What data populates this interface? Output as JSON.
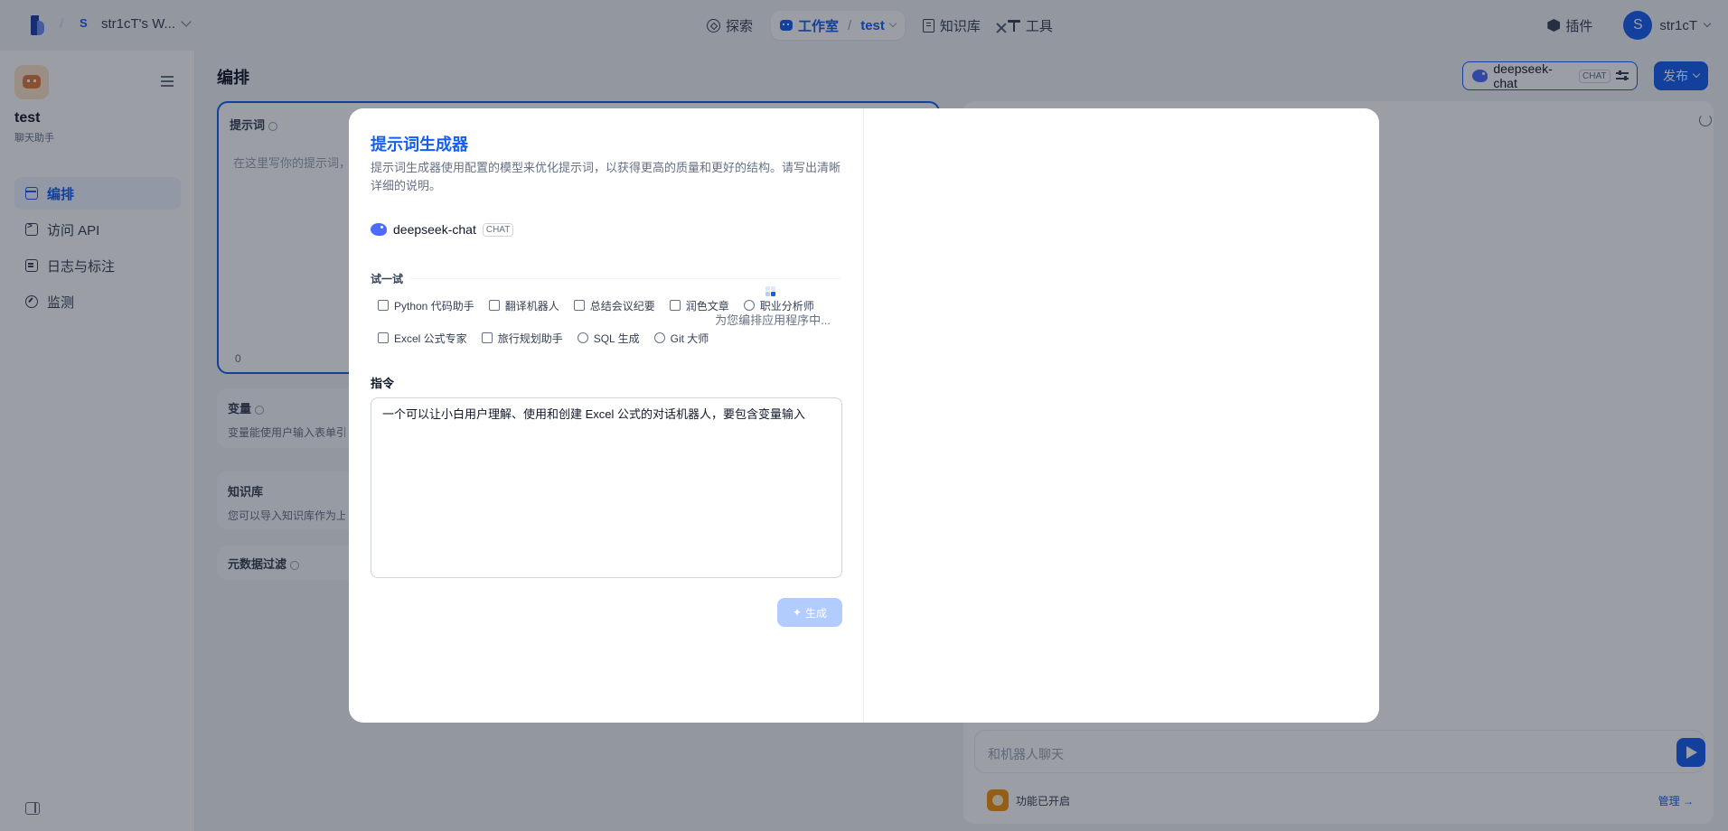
{
  "topbar": {
    "workspace_initial": "S",
    "workspace_name": "str1cT's W...",
    "nav": [
      {
        "label": "探索"
      },
      {
        "label": "工作室",
        "sub": "test"
      },
      {
        "label": "知识库"
      },
      {
        "label": "工具"
      }
    ],
    "nav_separator": "/",
    "plugin_label": "插件",
    "user_initial": "S",
    "user_name": "str1cT"
  },
  "sidebar": {
    "app_name": "test",
    "app_type": "聊天助手",
    "items": [
      {
        "label": "编排"
      },
      {
        "label": "访问 API"
      },
      {
        "label": "日志与标注"
      },
      {
        "label": "监测"
      }
    ]
  },
  "main": {
    "title": "编排",
    "model_name": "deepseek-chat",
    "model_tag": "CHAT",
    "publish_label": "发布",
    "prompt_label": "提示词",
    "prompt_placeholder": "在这里写你的提示词，",
    "prompt_count": "0",
    "variables_title": "变量",
    "variables_desc": "变量能使用户输入表单引",
    "knowledge_title": "知识库",
    "knowledge_desc": "您可以导入知识库作为上",
    "metadata_title": "元数据过滤",
    "chat_placeholder": "和机器人聊天",
    "feature_text": "功能已开启",
    "feature_link": "管理 →"
  },
  "modal": {
    "title": "提示词生成器",
    "description": "提示词生成器使用配置的模型来优化提示词，以获得更高的质量和更好的结构。请写出清晰详细的说明。",
    "model_name": "deepseek-chat",
    "model_tag": "CHAT",
    "try_label": "试一试",
    "try_items": [
      {
        "label": "Python 代码助手",
        "icon": "terminal-icon"
      },
      {
        "label": "翻译机器人",
        "icon": "translate-icon"
      },
      {
        "label": "总结会议纪要",
        "icon": "chart-icon"
      },
      {
        "label": "润色文章",
        "icon": "document-icon"
      },
      {
        "label": "职业分析师",
        "icon": "user-icon"
      },
      {
        "label": "Excel 公式专家",
        "icon": "excel-icon"
      },
      {
        "label": "旅行规划助手",
        "icon": "map-icon"
      },
      {
        "label": "SQL 生成",
        "icon": "database-icon"
      },
      {
        "label": "Git 大师",
        "icon": "git-icon"
      }
    ],
    "instruction_label": "指令",
    "instruction_value": "一个可以让小白用户理解、使用和创建 Excel 公式的对话机器人，要包含变量输入",
    "generate_label": "生成",
    "loading_text": "为您编排应用程序中..."
  },
  "colors": {
    "accent": "#155eef",
    "accent_disabled": "#b2ccff",
    "overlay": "rgba(16,24,40,0.42)",
    "loader_light": "#b2ccff"
  }
}
